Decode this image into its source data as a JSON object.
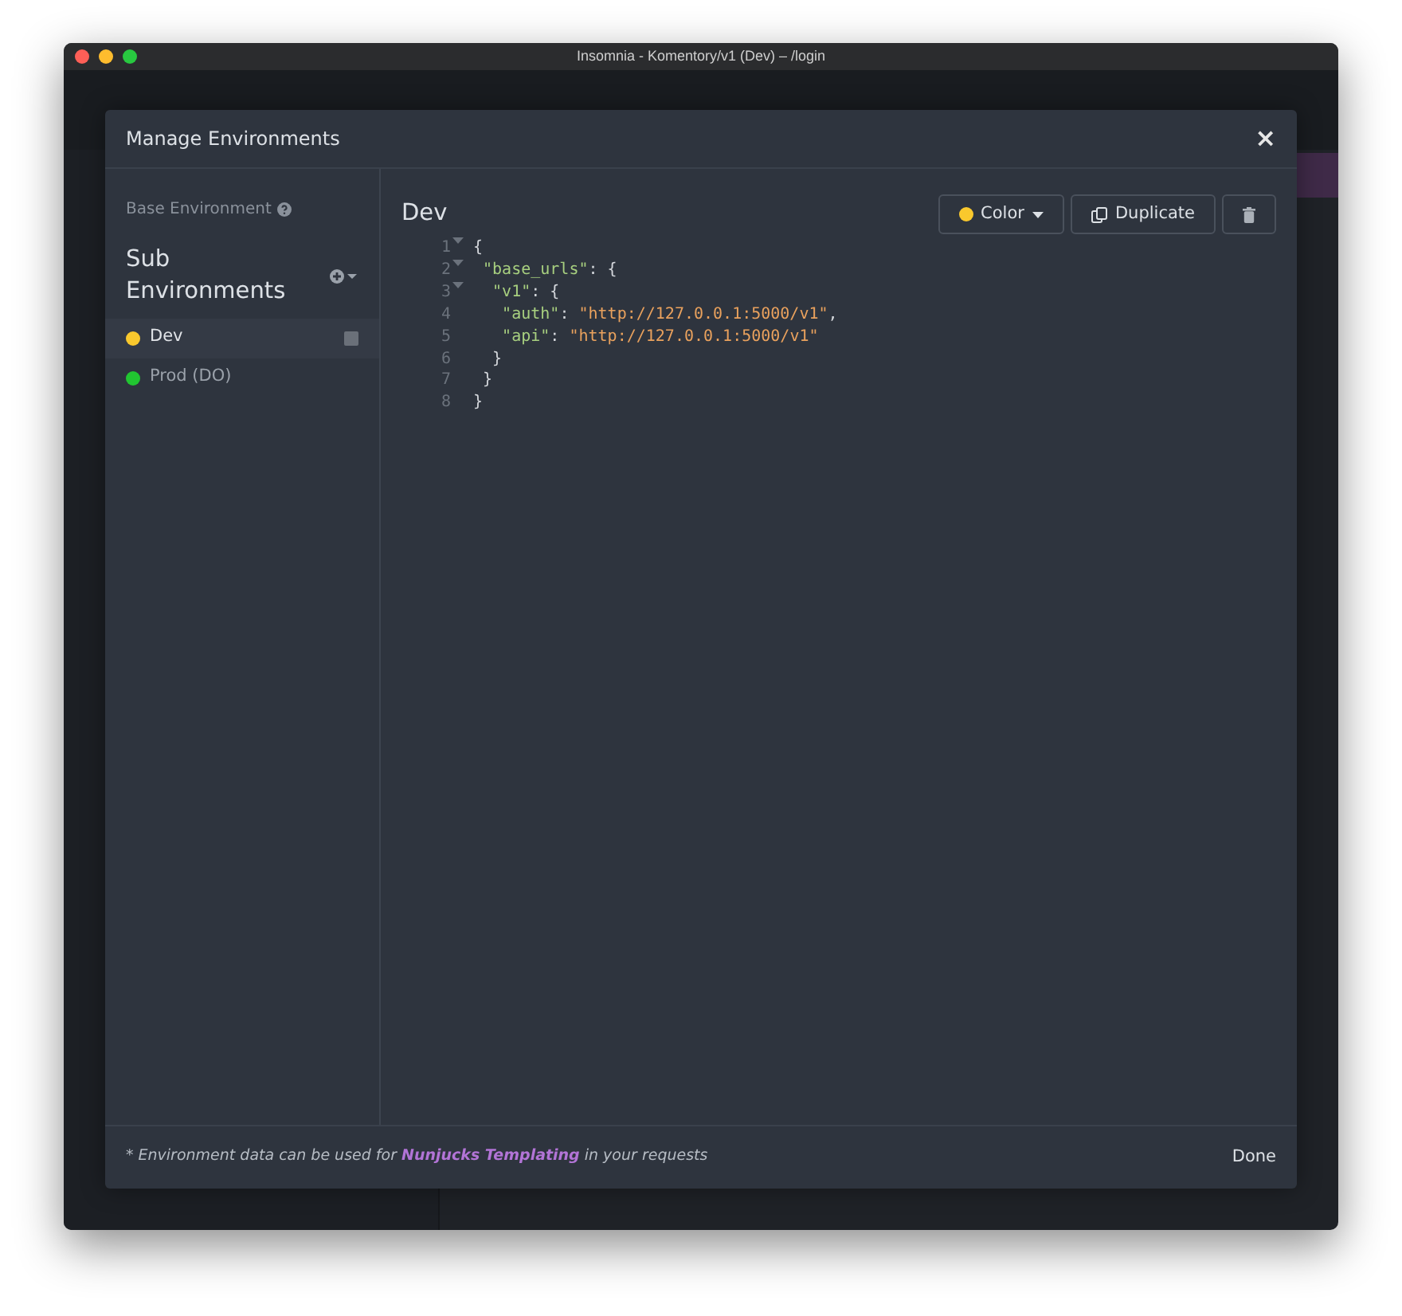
{
  "window": {
    "title": "Insomnia - Komentory/v1 (Dev) – /login"
  },
  "dialog": {
    "title": "Manage Environments",
    "close": "×"
  },
  "sidebar": {
    "base_environment": "Base Environment",
    "sub_heading": "Sub Environments",
    "items": [
      {
        "name": "Dev",
        "color": "#f9c82d",
        "selected": true
      },
      {
        "name": "Prod (DO)",
        "color": "#21c531",
        "selected": false
      }
    ]
  },
  "editor": {
    "title": "Dev",
    "buttons": [
      {
        "kind": "color",
        "label": "Color",
        "color": "#f9c82d"
      },
      {
        "kind": "duplicate",
        "label": "Duplicate"
      },
      {
        "kind": "delete"
      }
    ],
    "lines": [
      {
        "number": "1",
        "foldable": true,
        "tokens": [
          {
            "kind": "punct",
            "text": "{"
          }
        ]
      },
      {
        "number": "2",
        "foldable": true,
        "tokens": [
          {
            "kind": "key",
            "text": " \"base_urls\""
          },
          {
            "kind": "punct",
            "text": ": {"
          }
        ]
      },
      {
        "number": "3",
        "foldable": true,
        "tokens": [
          {
            "kind": "key",
            "text": "  \"v1\""
          },
          {
            "kind": "punct",
            "text": ": {"
          }
        ]
      },
      {
        "number": "4",
        "foldable": false,
        "tokens": [
          {
            "kind": "key",
            "text": "   \"auth\""
          },
          {
            "kind": "punct",
            "text": ": "
          },
          {
            "kind": "string",
            "text": "\"http://127.0.0.1:5000/v1\""
          },
          {
            "kind": "punct",
            "text": ","
          }
        ]
      },
      {
        "number": "5",
        "foldable": false,
        "tokens": [
          {
            "kind": "key",
            "text": "   \"api\""
          },
          {
            "kind": "punct",
            "text": ": "
          },
          {
            "kind": "string",
            "text": "\"http://127.0.0.1:5000/v1\""
          }
        ]
      },
      {
        "number": "6",
        "foldable": false,
        "tokens": [
          {
            "kind": "punct",
            "text": "  }"
          }
        ]
      },
      {
        "number": "7",
        "foldable": false,
        "tokens": [
          {
            "kind": "punct",
            "text": " }"
          }
        ]
      },
      {
        "number": "8",
        "foldable": false,
        "tokens": [
          {
            "kind": "punct",
            "text": "}"
          }
        ]
      }
    ]
  },
  "footer": {
    "note": "* Environment data can be used for **Nunjucks Templating** in your requests",
    "done": "Done"
  }
}
